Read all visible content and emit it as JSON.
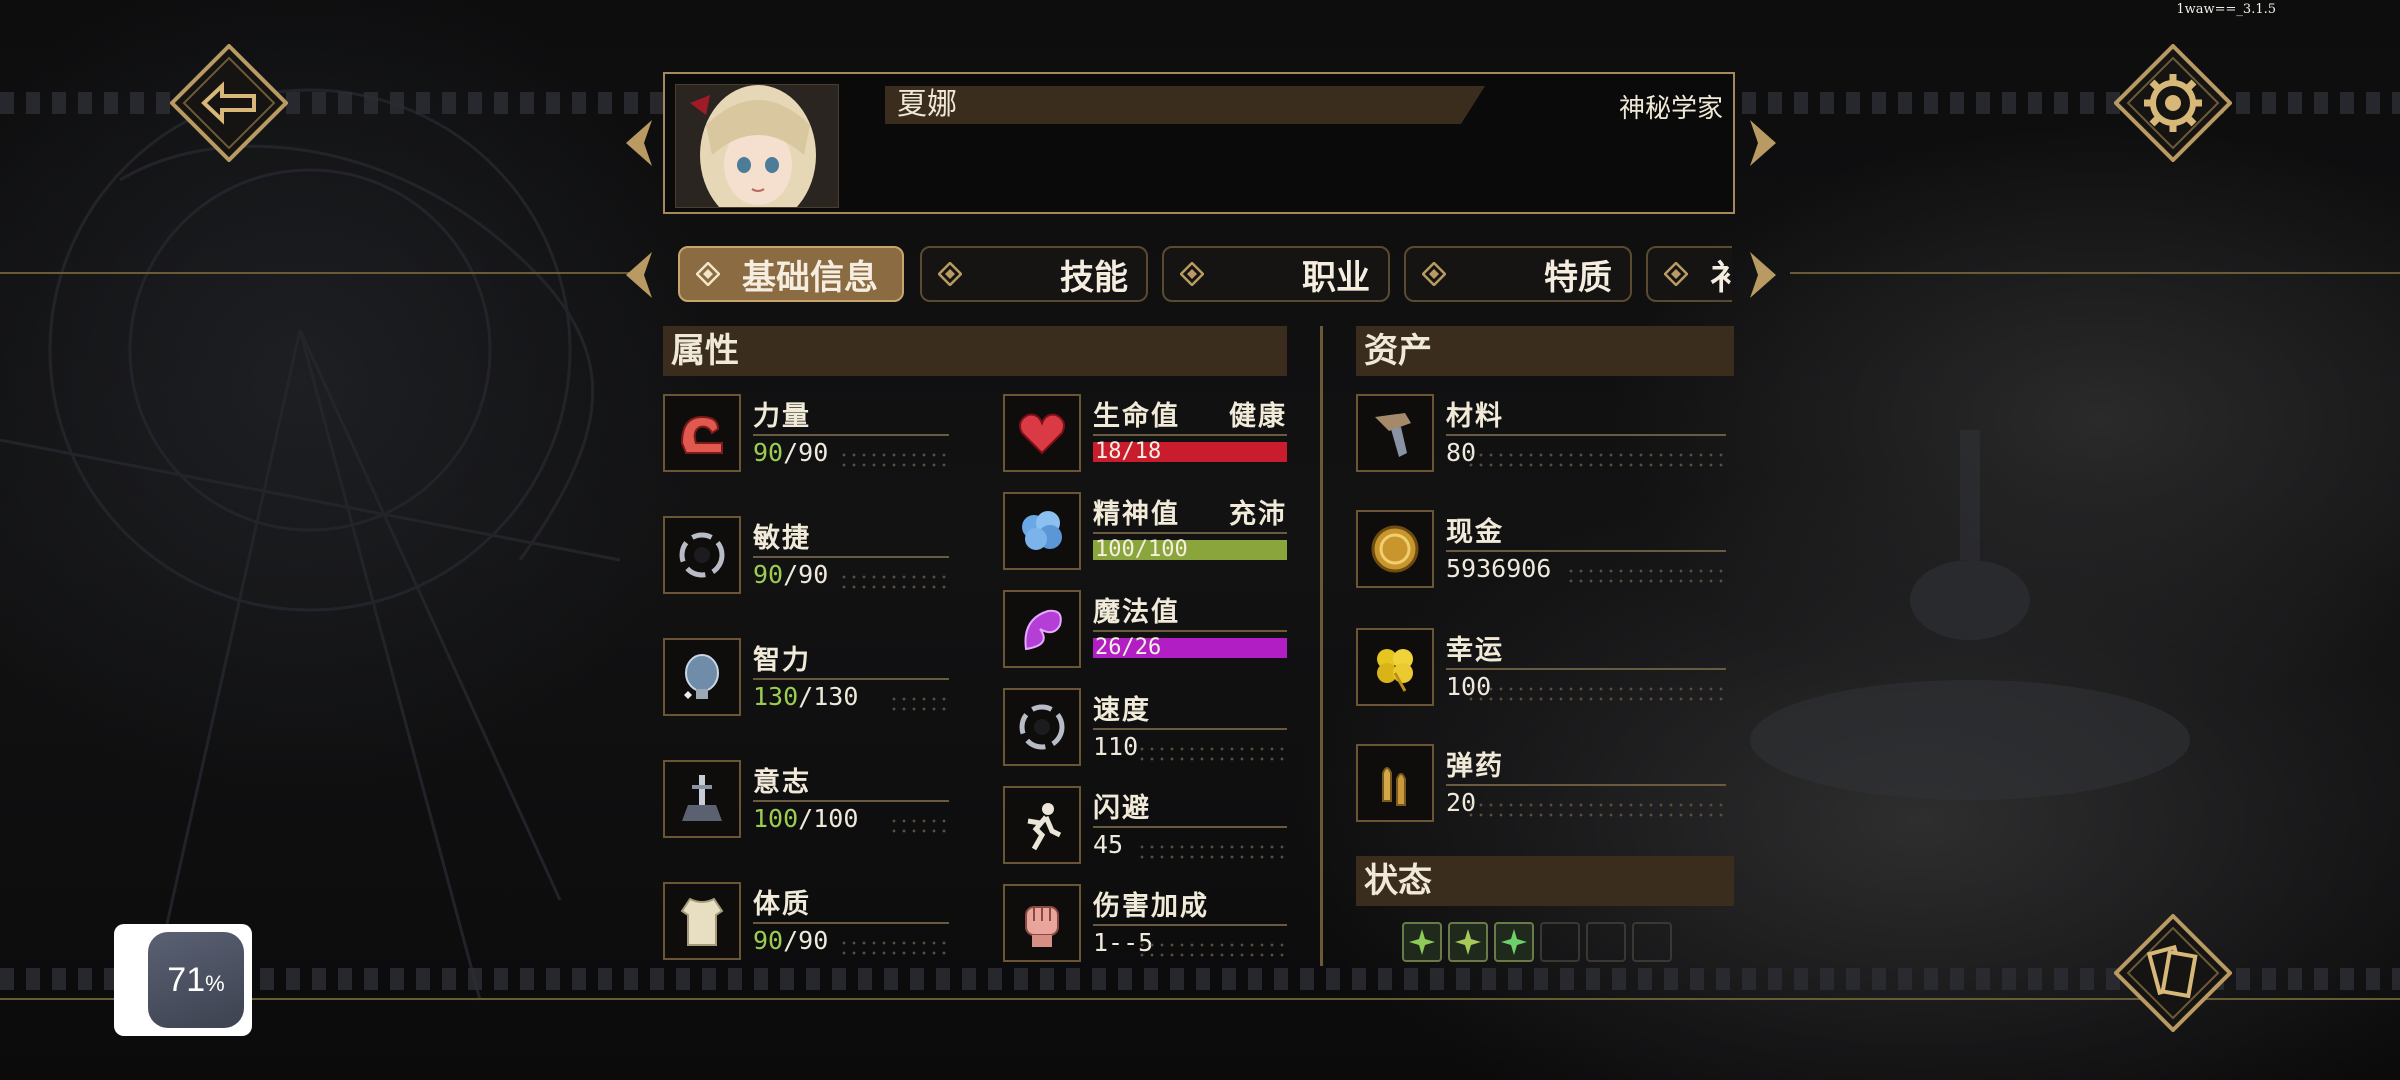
{
  "version": "1waw==_3.1.5",
  "character": {
    "name": "夏娜",
    "profession": "神秘学家"
  },
  "tabs": [
    {
      "label": "基础信息",
      "active": true
    },
    {
      "label": "技能",
      "active": false
    },
    {
      "label": "职业",
      "active": false
    },
    {
      "label": "特质",
      "active": false
    },
    {
      "label": "衤",
      "active": false
    }
  ],
  "attributes": {
    "title": "属性",
    "items": [
      {
        "label": "力量",
        "current": "90",
        "max": "90",
        "icon": "arm-muscle-icon"
      },
      {
        "label": "敏捷",
        "current": "90",
        "max": "90",
        "icon": "swirl-speed-icon"
      },
      {
        "label": "智力",
        "current": "130",
        "max": "130",
        "icon": "brain-icon"
      },
      {
        "label": "意志",
        "current": "100",
        "max": "100",
        "icon": "sword-stone-icon"
      },
      {
        "label": "体质",
        "current": "90",
        "max": "90",
        "icon": "torso-icon"
      }
    ]
  },
  "vitals": {
    "items": [
      {
        "label": "生命值",
        "status": "健康",
        "value": "18/18",
        "icon": "heart-icon",
        "color": "#c91d2e",
        "fill": 1.0
      },
      {
        "label": "精神值",
        "status": "充沛",
        "value": "100/100",
        "icon": "brain-cloud-icon",
        "color": "#8aa53c",
        "fill": 1.0
      },
      {
        "label": "魔法值",
        "status": "",
        "value": "26/26",
        "icon": "magic-swirl-icon",
        "color": "#b01ec4",
        "fill": 1.0
      }
    ],
    "stats": [
      {
        "label": "速度",
        "value": "110",
        "icon": "swirl-speed-icon"
      },
      {
        "label": "闪避",
        "value": "45",
        "icon": "dodge-figure-icon"
      },
      {
        "label": "伤害加成",
        "value": "1--5",
        "icon": "fist-icon"
      }
    ]
  },
  "assets": {
    "title": "资产",
    "items": [
      {
        "label": "材料",
        "value": "80",
        "icon": "materials-icon"
      },
      {
        "label": "现金",
        "value": "5936906",
        "icon": "coin-icon"
      },
      {
        "label": "幸运",
        "value": "100",
        "icon": "clover-icon"
      },
      {
        "label": "弹药",
        "value": "20",
        "icon": "bullets-icon"
      }
    ]
  },
  "status": {
    "title": "状态",
    "filled_slots": 3,
    "total_slots": 6
  },
  "floating_widget": {
    "percent": "71",
    "unit": "%"
  }
}
